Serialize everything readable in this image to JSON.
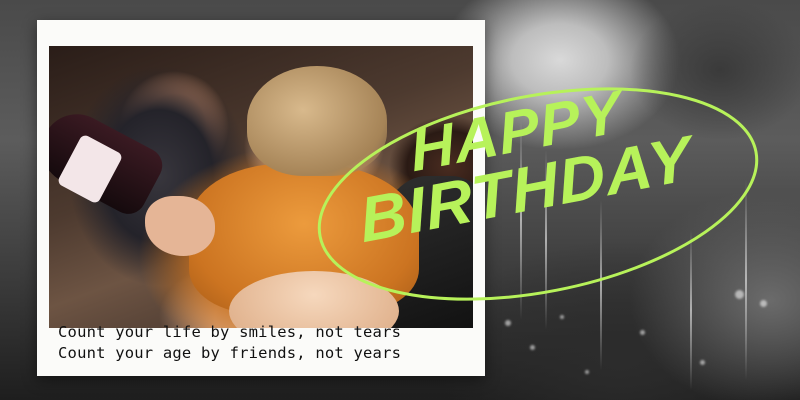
{
  "headline": {
    "line1": "HAPPY",
    "line2": "BIRTHDAY"
  },
  "quote": {
    "line1": "Count your life by smiles, not tears",
    "line2": "Count your age by friends, not years"
  },
  "colors": {
    "accent": "#b7f25a",
    "frame": "#fbfbf9",
    "text": "#111111"
  },
  "photo": {
    "subject": "three friends laughing at a party, one holding a bottle"
  }
}
